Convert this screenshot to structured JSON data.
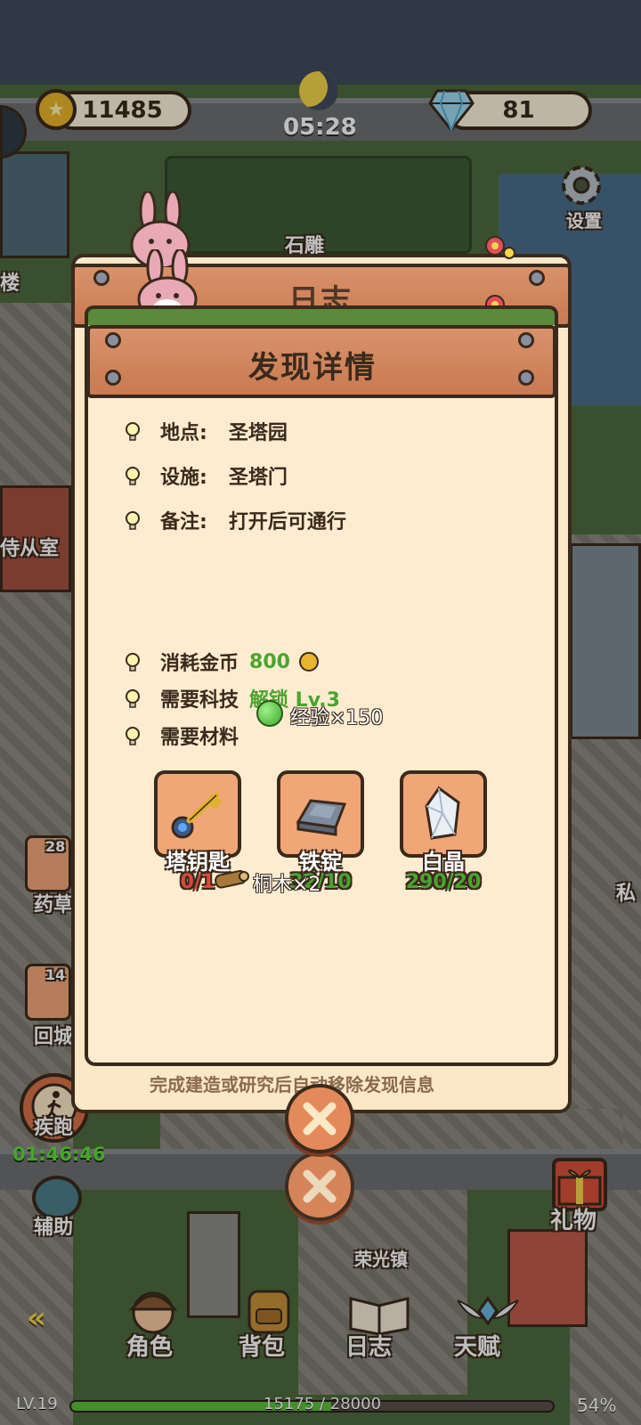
{
  "hud": {
    "coins": "11485",
    "gems": "81",
    "clock": "05:28",
    "settings_label": "设置"
  },
  "map": {
    "statue_label": "石雕",
    "tower_label": "楼",
    "servant_room_label": "侍从室",
    "herb_label": "药草",
    "herb_count": "28",
    "return_city_label": "回城",
    "return_city_count": "14",
    "town_label": "荣光镇",
    "right_label": "私"
  },
  "side": {
    "sprint_label": "疾跑",
    "sprint_timer": "01:46:46",
    "assist_label": "辅助",
    "gift_label": "礼物"
  },
  "nav": {
    "items": [
      {
        "label": "角色"
      },
      {
        "label": "背包"
      },
      {
        "label": "日志"
      },
      {
        "label": "天赋"
      }
    ]
  },
  "exp": {
    "level": "LV.19",
    "progress_text": "15175 / 28000",
    "percent": "54%",
    "fraction": 0.54
  },
  "back_dialog": {
    "title": "日志",
    "footer_hint": "完成建造或研究后自动移除发现信息"
  },
  "dialog": {
    "title": "发现详情",
    "info": [
      {
        "label": "地点:",
        "value": "圣塔园"
      },
      {
        "label": "设施:",
        "value": "圣塔门"
      },
      {
        "label": "备注:",
        "value": "打开后可通行"
      }
    ],
    "cost_label": "消耗金币",
    "cost_value": "800",
    "tech_label": "需要科技",
    "tech_value": "解锁 Lv.3",
    "exp_reward": "经验×150",
    "material_label": "需要材料",
    "materials": [
      {
        "name": "塔钥匙",
        "count": "0/1",
        "icon": "key-icon",
        "status_color": "#d94a3a"
      },
      {
        "name": "铁锭",
        "count": "32/10",
        "icon": "iron-ingot-icon",
        "status_color": "#4aa42f"
      },
      {
        "name": "白晶",
        "count": "290/20",
        "icon": "white-crystal-icon",
        "status_color": "#4aa42f"
      }
    ],
    "wood_drop": "桐木×2"
  },
  "colors": {
    "panel": "#fdecd0",
    "plank": "#d9926a",
    "outline": "#3a2a1c",
    "accent_green": "#4aa42f",
    "accent_red": "#d94a3a"
  }
}
